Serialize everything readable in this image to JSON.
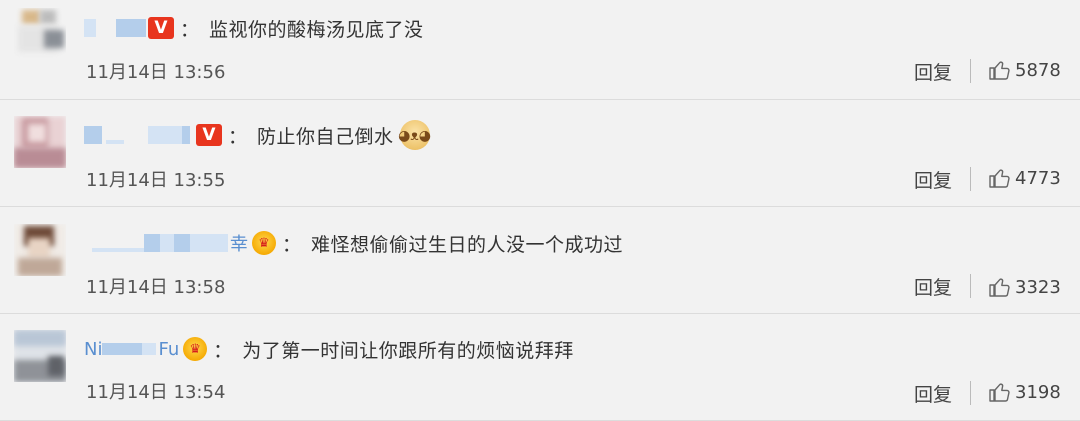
{
  "comments": [
    {
      "text": "监视你的酸梅汤见底了没",
      "time": "11月14日 13:56",
      "reply": "回复",
      "likes": "5878",
      "badge": "V"
    },
    {
      "text": "防止你自己倒水",
      "time": "11月14日 13:55",
      "reply": "回复",
      "likes": "4773",
      "badge": "V"
    },
    {
      "name_fragment": "幸",
      "text": "难怪想偷偷过生日的人没一个成功过",
      "time": "11月14日 13:58",
      "reply": "回复",
      "likes": "3323"
    },
    {
      "name_fragment_start": "Ni",
      "name_fragment_end": "Fu",
      "text": "为了第一时间让你跟所有的烦恼说拜拜",
      "time": "11月14日 13:54",
      "reply": "回复",
      "likes": "3198"
    }
  ],
  "colon": "：",
  "colors": {
    "background": "#f2f2f2",
    "username": "#5a8fd0",
    "vip_badge": "#e8351e",
    "divider": "#dcdcdc"
  },
  "icons": {
    "like": "thumbs-up-icon",
    "verified": "vip-badge-icon",
    "crown": "crown-badge-icon",
    "emoji": "doge-emoji-icon"
  }
}
